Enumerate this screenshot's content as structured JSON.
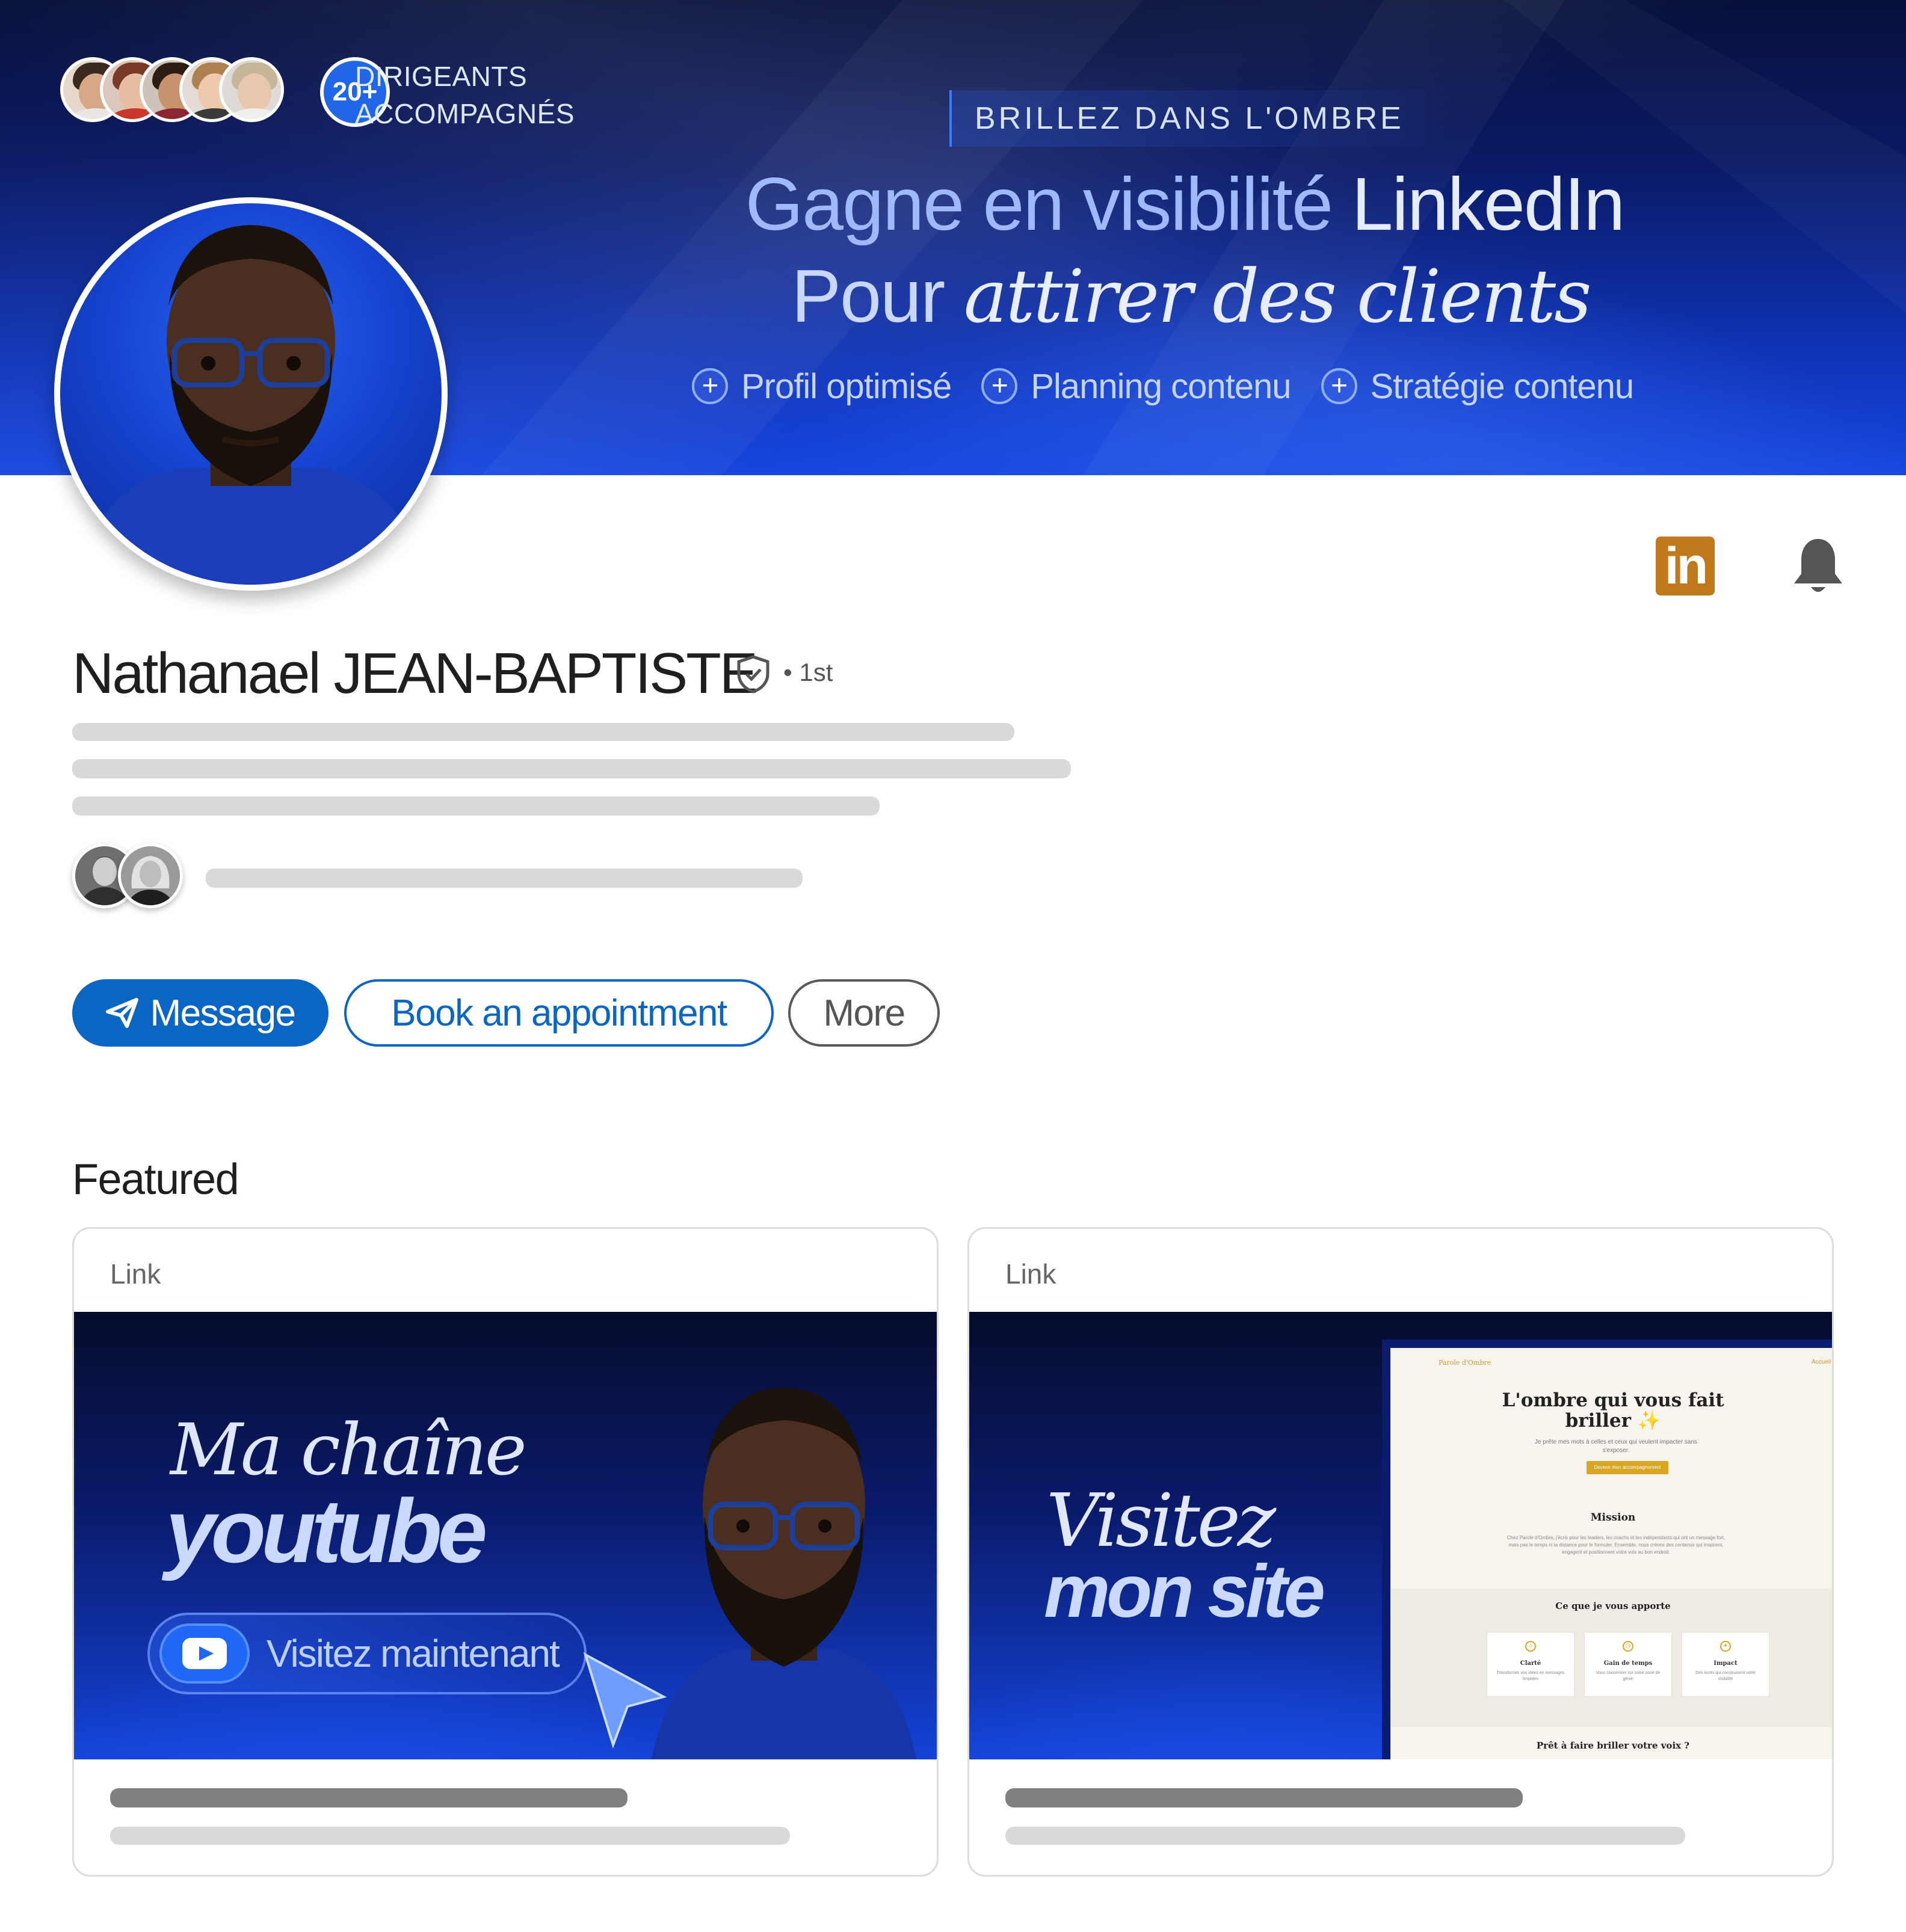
{
  "banner": {
    "lead_count": "20+",
    "lead_line1": "DIRIGEANTS",
    "lead_line2": "ACCOMPAGNÉS",
    "kicker": "BRILLEZ DANS L'OMBRE",
    "headline_part1": "Gagne en visibilité",
    "headline_part2": " LinkedIn",
    "headline2_part1": "Pour ",
    "headline2_part2": "attirer des clients",
    "pills": [
      "Profil optimisé",
      "Planning contenu",
      "Stratégie contenu"
    ]
  },
  "profile": {
    "name": "Nathanael JEAN-BAPTISTE",
    "degree": "• 1st"
  },
  "actions": {
    "message_label": "Message",
    "book_label": "Book an appointment",
    "more_label": "More"
  },
  "featured": {
    "title": "Featured",
    "cards": [
      {
        "label": "Link",
        "title_line1": "Ma chaîne",
        "title_line2": "youtube",
        "cta": "Visitez maintenant"
      },
      {
        "label": "Link",
        "title_line1": "Visitez",
        "title_line2": "mon site",
        "mock": {
          "brand": "Parole d'Ombre",
          "nav": "Accueil",
          "heading_line1": "L'ombre qui vous fait",
          "heading_line2": "briller ✨",
          "sub": "Je prête mes mots à celles et ceux qui veulent impacter sans s'exposer.",
          "cta": "Devenir mon accompagnement",
          "mission_title": "Mission",
          "mission_text": "Chez Parole d'Ombre, j'écris pour les leaders, les coachs et les indépendants qui ont un message fort, mais pas le temps ni la distance pour le formuler. Ensemble, nous créons des contenus qui inspirent, engagent et positionnent votre voix au bon endroit.",
          "benefits_title": "Ce que je vous apporte",
          "benefits": [
            {
              "title": "Clarté",
              "text": "Transformer vos idées en messages limpides"
            },
            {
              "title": "Gain de temps",
              "text": "Vous concentrer sur votre zone de génie"
            },
            {
              "title": "Impact",
              "text": "Des écrits qui construisent votre visibilité"
            }
          ],
          "closing": "Prêt à faire briller votre voix ?"
        }
      }
    ]
  },
  "colors": {
    "linkedin_blue": "#0a66c2",
    "banner_blue": "#1646e0",
    "accent_gold": "#c07a1c"
  },
  "icons": [
    "linkedin-icon",
    "bell-icon",
    "shield-check-icon",
    "send-icon",
    "play-icon",
    "plus-icon",
    "cursor-icon"
  ]
}
